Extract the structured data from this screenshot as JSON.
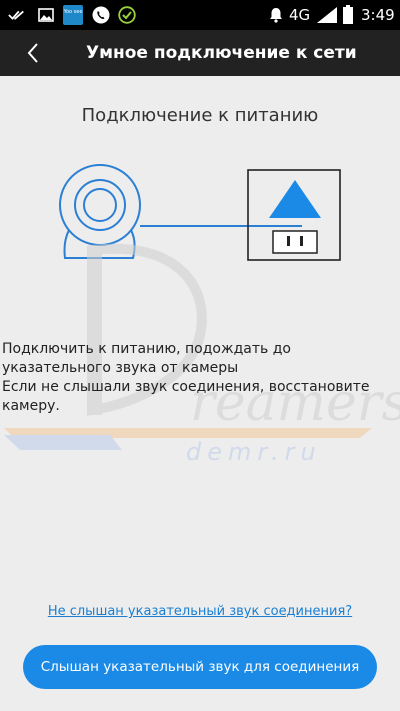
{
  "status_bar": {
    "network": "4G",
    "time": "3:49",
    "left_icons": [
      "double-check-icon",
      "image-icon",
      "app-icon",
      "phone-icon",
      "check-circle-icon"
    ],
    "app_icon_text": "Yoo see",
    "right_icons": [
      "alarm-icon",
      "signal-icon",
      "battery-icon"
    ]
  },
  "app_bar": {
    "back_icon": "chevron-left-icon",
    "title": "Умное подключение к сети"
  },
  "main": {
    "heading": "Подключение к питанию",
    "instruction": "Подключить к питанию, подождать до указательного звука от камеры\n Если не слышали звук соединения, восстановите камеру.",
    "help_link": "Не слышан указательный звук соединения?",
    "confirm_button": "Слышан указательный звук для соединения"
  },
  "watermark": {
    "logo_text": "Dreamers",
    "site": "demr.ru"
  },
  "colors": {
    "accent": "#1a8ae6",
    "link": "#1a7fd1",
    "app_bar": "#222222",
    "background": "#ededed"
  }
}
